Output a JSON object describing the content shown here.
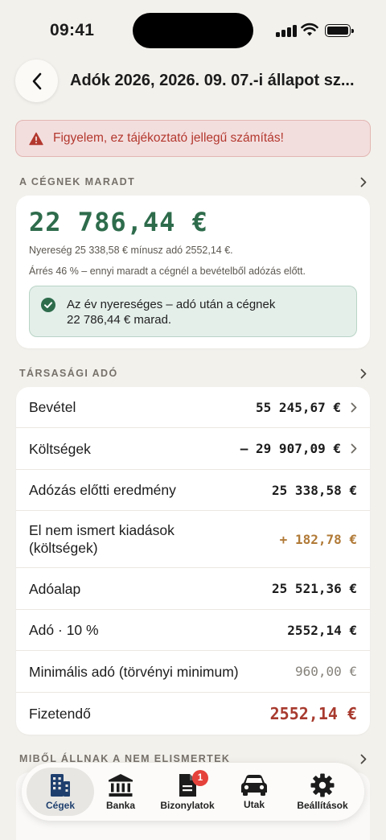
{
  "status_bar": {
    "time": "09:41"
  },
  "header": {
    "title": "Adók 2026, 2026. 09. 07.-i állapot sz..."
  },
  "warning": {
    "text": "Figyelem, ez tájékoztató jellegű számítás!"
  },
  "result_section": {
    "label": "A CÉGNEK MARADT",
    "amount": "22 786,44 €",
    "profit_line": "Nyereség 25 338,58 € mínusz adó 2552,14 €.",
    "margin_line": "Árrés 46 % – ennyi maradt a cégnél a bevételből adózás előtt.",
    "success_text_1": "Az év nyereséges – adó után a cégnek",
    "success_text_2": "22 786,44 € marad."
  },
  "tax_section": {
    "label": "TÁRSASÁGI ADÓ",
    "rows": [
      {
        "label": "Bevétel",
        "value": "55 245,67 €"
      },
      {
        "label": "Költségek",
        "value": "– 29 907,09 €"
      },
      {
        "label": "Adózás előtti eredmény",
        "value": "25 338,58 €"
      },
      {
        "label": "El nem ismert kiadások",
        "label_2": "(költségek)",
        "value": "+ 182,78 €"
      },
      {
        "label": "Adóalap",
        "value": "25 521,36 €"
      },
      {
        "label": "Adó · 10 %",
        "value": "2552,14 €"
      },
      {
        "label": "Minimális adó (törvényi minimum)",
        "value": "960,00 €"
      },
      {
        "label": "Fizetendő",
        "value": "2552,14 €"
      }
    ]
  },
  "next_section": {
    "label": "MIBŐL ÁLLNAK A NEM ELISMERTEK"
  },
  "tabs": [
    {
      "label": "Cégek",
      "icon": "building-icon",
      "active": true
    },
    {
      "label": "Banka",
      "icon": "bank-icon"
    },
    {
      "label": "Bizonylatok",
      "icon": "document-icon",
      "badge": "1"
    },
    {
      "label": "Utak",
      "icon": "car-icon"
    },
    {
      "label": "Beállítások",
      "icon": "gear-icon"
    }
  ],
  "colors": {
    "accent_green": "#2e6c4c",
    "warning_red": "#b3382e",
    "orange": "#b17a37",
    "payable_red": "#a83a2e",
    "tab_active": "#1e3f6e",
    "badge_red": "#e5423b"
  }
}
